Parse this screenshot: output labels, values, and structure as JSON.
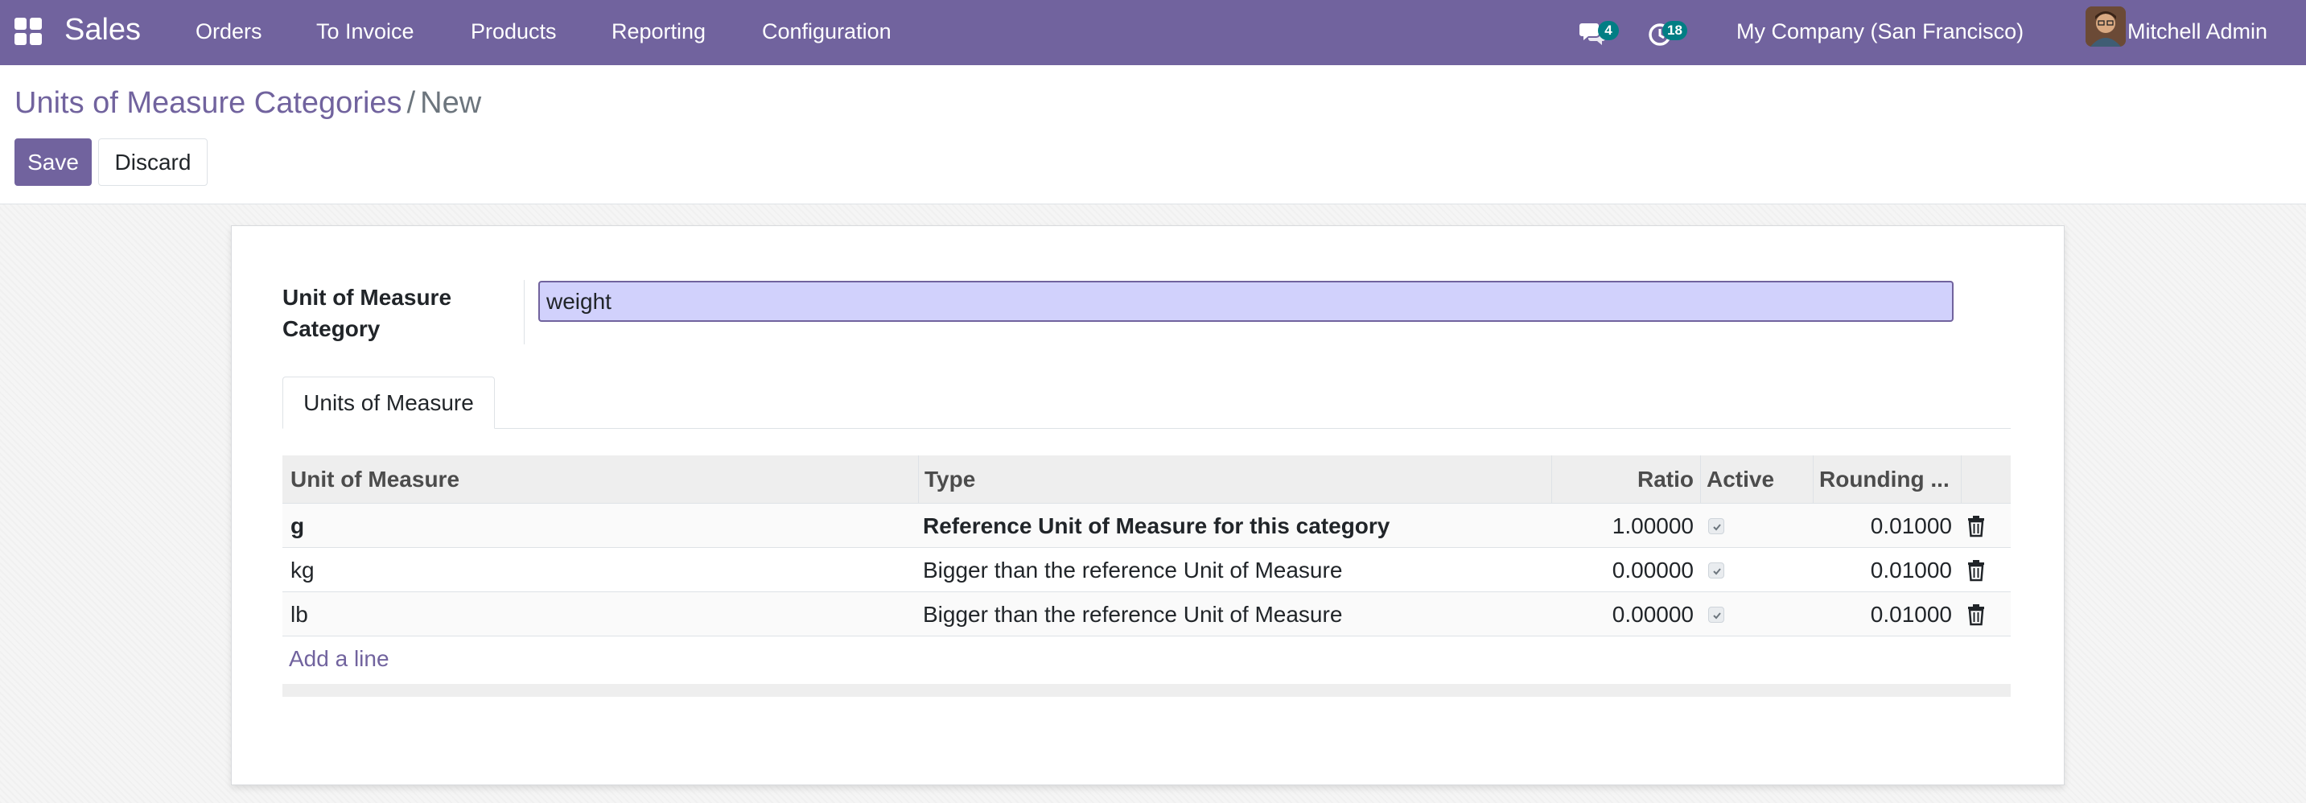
{
  "navbar": {
    "app_name": "Sales",
    "menu": [
      "Orders",
      "To Invoice",
      "Products",
      "Reporting",
      "Configuration"
    ],
    "messages_count": "4",
    "activities_count": "18",
    "company": "My Company (San Francisco)",
    "user": "Mitchell Admin",
    "color": "#71639e"
  },
  "breadcrumb": {
    "parent": "Units of Measure Categories",
    "separator": "/",
    "current": "New"
  },
  "actions": {
    "save": "Save",
    "discard": "Discard"
  },
  "form": {
    "category_label": "Unit of Measure Category",
    "category_value": "weight",
    "tab": "Units of Measure"
  },
  "table": {
    "headers": [
      "Unit of Measure",
      "Type",
      "Ratio",
      "Active",
      "Rounding ..."
    ],
    "rows": [
      {
        "uom": "g",
        "type": "Reference Unit of Measure for this category",
        "ratio": "1.00000",
        "active": true,
        "rounding": "0.01000"
      },
      {
        "uom": "kg",
        "type": "Bigger than the reference Unit of Measure",
        "ratio": "0.00000",
        "active": true,
        "rounding": "0.01000"
      },
      {
        "uom": "lb",
        "type": "Bigger than the reference Unit of Measure",
        "ratio": "0.00000",
        "active": true,
        "rounding": "0.01000"
      }
    ],
    "add_line": "Add a line"
  }
}
